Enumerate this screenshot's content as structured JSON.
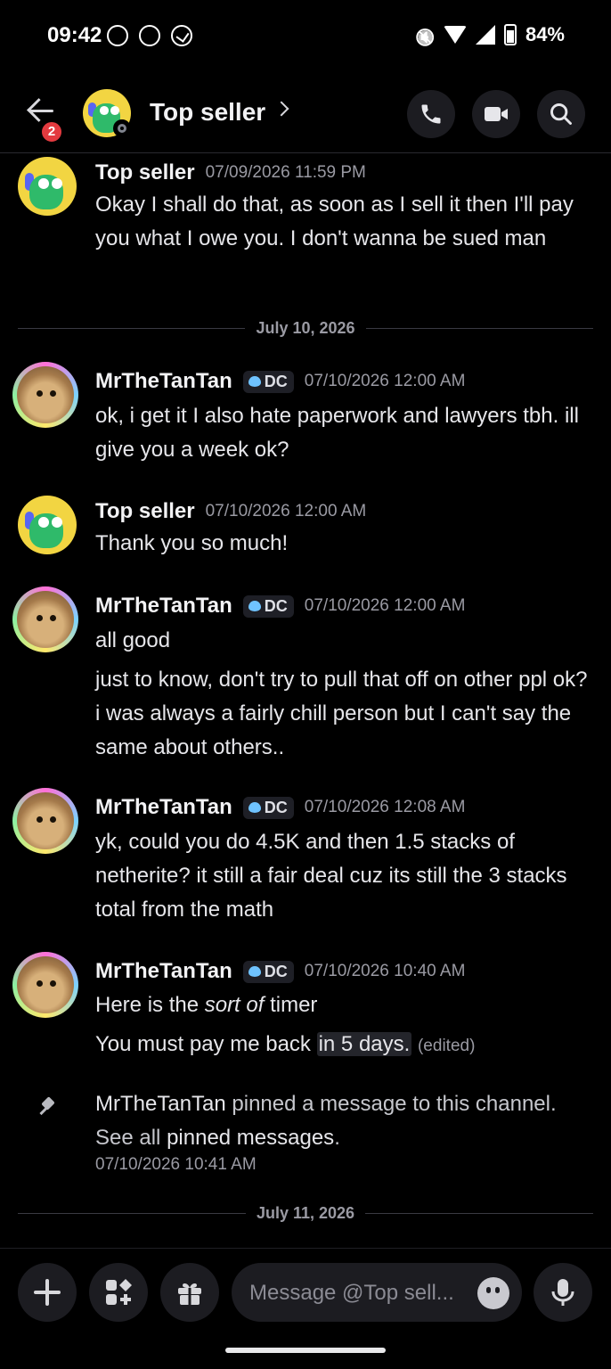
{
  "status_bar": {
    "time": "09:42",
    "battery": "84%"
  },
  "header": {
    "badge_count": "2",
    "title": "Top seller"
  },
  "composer": {
    "placeholder": "Message @Top sell..."
  },
  "messages": [
    {
      "author": "Top seller",
      "time": "07/09/2026 11:59 PM",
      "text": "Okay I shall do that, as soon as I sell it then I'll pay you what I owe you. I don't wanna be sued man"
    },
    {
      "author": "MrTheTanTan",
      "tag": "DC",
      "time": "07/10/2026 12:00 AM",
      "text": "ok, i get it I also hate paperwork and lawyers tbh. ill give you a week ok?"
    },
    {
      "author": "Top seller",
      "time": "07/10/2026 12:00 AM",
      "text": "Thank you so much!"
    },
    {
      "author": "MrTheTanTan",
      "tag": "DC",
      "time": "07/10/2026 12:00 AM",
      "text": "all good",
      "text2": "just to know, don't try to pull that off on other ppl ok? i was always a fairly chill person but I can't say the same about others.."
    },
    {
      "author": "MrTheTanTan",
      "tag": "DC",
      "time": "07/10/2026 12:08 AM",
      "text": "yk, could you do 4.5K and then 1.5 stacks of netherite? it still a fair deal cuz its still the 3 stacks total from the math"
    },
    {
      "author": "MrTheTanTan",
      "tag": "DC",
      "time": "07/10/2026 10:40 AM",
      "text_pre": "Here is the ",
      "text_em": "sort of",
      "text_post": " timer",
      "text2_pre": "You must pay me back ",
      "text2_hl": "in 5 days.",
      "edited": "(edited)"
    }
  ],
  "dividers": [
    "July 10, 2026",
    "July 11, 2026"
  ],
  "system": {
    "author": "MrTheTanTan",
    "text": " pinned a message to this channel. See all ",
    "link": "pinned messages",
    "end": ".",
    "time": "07/10/2026 10:41 AM"
  }
}
